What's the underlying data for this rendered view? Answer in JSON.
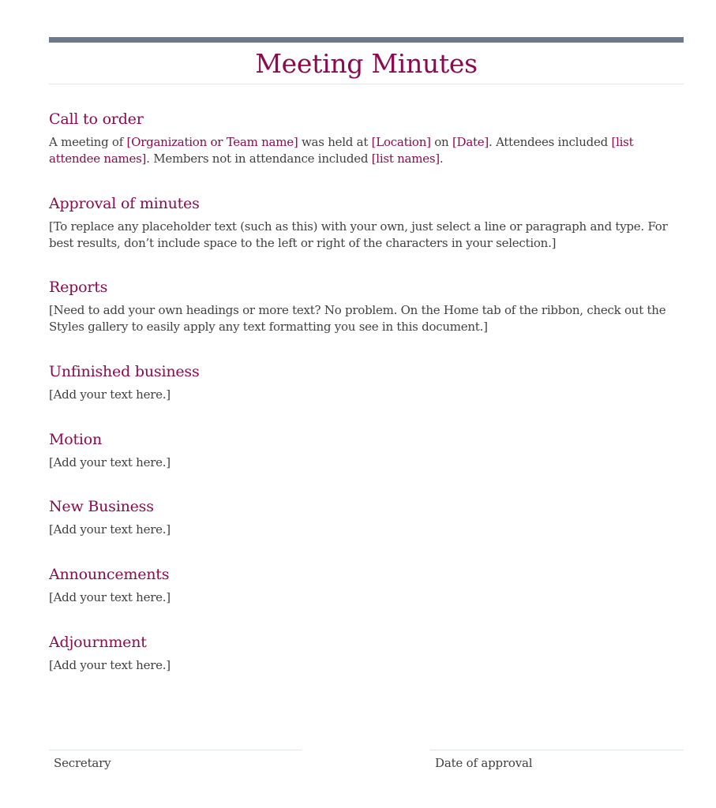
{
  "document": {
    "title": "Meeting Minutes",
    "accent_color": "#8b0a50",
    "bar_color": "#6b7b8c"
  },
  "call_to_order": {
    "heading": "Call to order",
    "t1": "A meeting of ",
    "org_placeholder": "[Organization or Team name]",
    "t2": " was held at ",
    "location_placeholder": "[Location]",
    "t3": " on ",
    "date_placeholder": "[Date]",
    "t4": ". Attendees included ",
    "attendees_placeholder": "[list attendee names]",
    "t5": ". Members not in attendance included ",
    "absent_placeholder": "[list names]",
    "t6": "."
  },
  "sections": [
    {
      "heading": "Approval of minutes",
      "text": "[To replace any placeholder text (such as this) with your own, just select a line or paragraph and type. For best results, don’t include space to the left or right of the characters in your selection.]"
    },
    {
      "heading": "Reports",
      "text": "[Need to add your own headings or more text? No problem. On the Home tab of the ribbon, check out the Styles gallery to easily apply any text formatting you see in this document.]"
    },
    {
      "heading": "Unfinished business",
      "text": "[Add your text here.]"
    },
    {
      "heading": "Motion",
      "text": "[Add your text here.]"
    },
    {
      "heading": "New Business",
      "text": "[Add your text here.]"
    },
    {
      "heading": "Announcements",
      "text": "[Add your text here.]"
    },
    {
      "heading": "Adjournment",
      "text": "[Add your text here.]"
    }
  ],
  "signatures": {
    "secretary_label": "Secretary",
    "date_label": "Date of approval"
  }
}
